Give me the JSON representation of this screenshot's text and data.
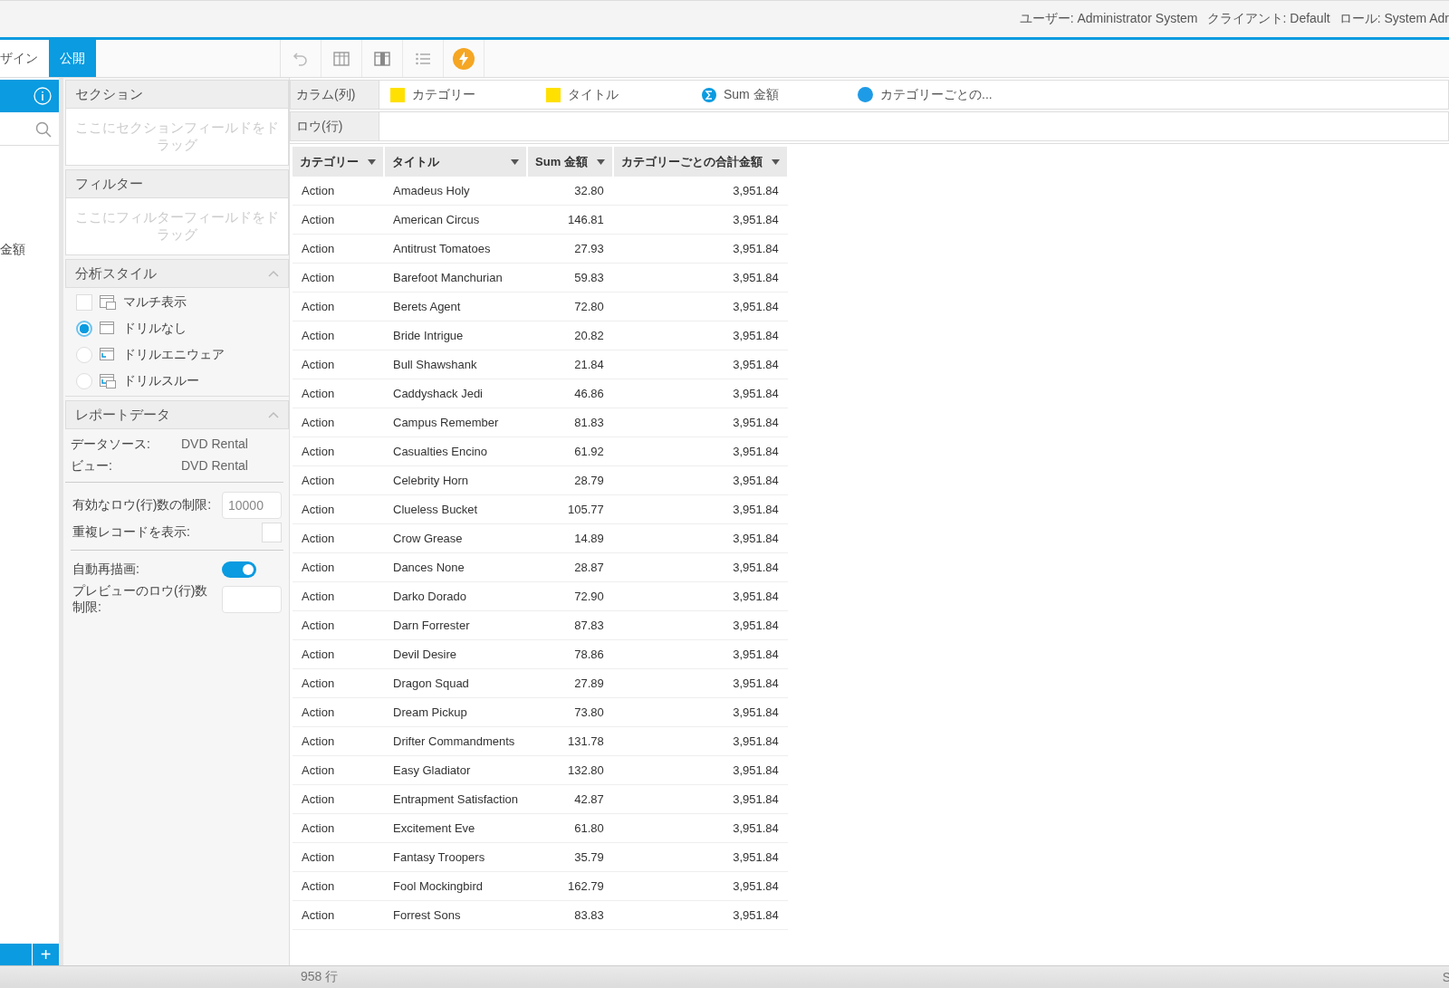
{
  "header": {
    "items": [
      "ユーザー: Administrator System",
      "クライアント: Default",
      "ロール: System Adr"
    ]
  },
  "tabs": [
    {
      "label": "ザイン",
      "selected": false
    },
    {
      "label": "公開",
      "selected": true
    }
  ],
  "sidebar": {
    "partial_label": "金額",
    "add_button": "+"
  },
  "section_panel": {
    "title": "セクション",
    "placeholder": "ここにセクションフィールドをドラッグ"
  },
  "filter_panel": {
    "title": "フィルター",
    "placeholder": "ここにフィルターフィールドをドラッグ"
  },
  "analysis_style": {
    "title": "分析スタイル",
    "expanded": true,
    "options": [
      {
        "label": "マルチ表示",
        "kind": "checkbox",
        "checked": false
      },
      {
        "label": "ドリルなし",
        "kind": "radio",
        "selected": true
      },
      {
        "label": "ドリルエニウェア",
        "kind": "radio",
        "selected": false
      },
      {
        "label": "ドリルスルー",
        "kind": "radio",
        "selected": false
      }
    ]
  },
  "report_data": {
    "title": "レポートデータ",
    "expanded": true,
    "info": [
      {
        "label": "データソース:",
        "value": "DVD Rental"
      },
      {
        "label": "ビュー:",
        "value": "DVD Rental"
      }
    ],
    "row_limit": {
      "label": "有効なロウ(行)数の制限:",
      "value": "10000"
    },
    "duplicates": {
      "label": "重複レコードを表示:",
      "checked": false
    },
    "auto_refresh": {
      "label": "自動再描画:",
      "on": true
    },
    "preview_limit": {
      "label": "プレビューのロウ(行)数制限:"
    }
  },
  "columns_shelf": {
    "label": "カラム(列)",
    "items": [
      {
        "label": "カテゴリー",
        "kind": "dimension"
      },
      {
        "label": "タイトル",
        "kind": "dimension"
      },
      {
        "label": "Sum 金額",
        "kind": "measure"
      },
      {
        "label": "カテゴリーごとの...",
        "kind": "calculated"
      }
    ]
  },
  "rows_shelf": {
    "label": "ロウ(行)"
  },
  "table": {
    "columns": [
      "カテゴリー",
      "タイトル",
      "Sum 金額",
      "カテゴリーごとの合計金額"
    ],
    "rows": [
      [
        "Action",
        "Amadeus Holy",
        "32.80",
        "3,951.84"
      ],
      [
        "Action",
        "American Circus",
        "146.81",
        "3,951.84"
      ],
      [
        "Action",
        "Antitrust Tomatoes",
        "27.93",
        "3,951.84"
      ],
      [
        "Action",
        "Barefoot Manchurian",
        "59.83",
        "3,951.84"
      ],
      [
        "Action",
        "Berets Agent",
        "72.80",
        "3,951.84"
      ],
      [
        "Action",
        "Bride Intrigue",
        "20.82",
        "3,951.84"
      ],
      [
        "Action",
        "Bull Shawshank",
        "21.84",
        "3,951.84"
      ],
      [
        "Action",
        "Caddyshack Jedi",
        "46.86",
        "3,951.84"
      ],
      [
        "Action",
        "Campus Remember",
        "81.83",
        "3,951.84"
      ],
      [
        "Action",
        "Casualties Encino",
        "61.92",
        "3,951.84"
      ],
      [
        "Action",
        "Celebrity Horn",
        "28.79",
        "3,951.84"
      ],
      [
        "Action",
        "Clueless Bucket",
        "105.77",
        "3,951.84"
      ],
      [
        "Action",
        "Crow Grease",
        "14.89",
        "3,951.84"
      ],
      [
        "Action",
        "Dances None",
        "28.87",
        "3,951.84"
      ],
      [
        "Action",
        "Darko Dorado",
        "72.90",
        "3,951.84"
      ],
      [
        "Action",
        "Darn Forrester",
        "87.83",
        "3,951.84"
      ],
      [
        "Action",
        "Devil Desire",
        "78.86",
        "3,951.84"
      ],
      [
        "Action",
        "Dragon Squad",
        "27.89",
        "3,951.84"
      ],
      [
        "Action",
        "Dream Pickup",
        "73.80",
        "3,951.84"
      ],
      [
        "Action",
        "Drifter Commandments",
        "131.78",
        "3,951.84"
      ],
      [
        "Action",
        "Easy Gladiator",
        "132.80",
        "3,951.84"
      ],
      [
        "Action",
        "Entrapment Satisfaction",
        "42.87",
        "3,951.84"
      ],
      [
        "Action",
        "Excitement Eve",
        "61.80",
        "3,951.84"
      ],
      [
        "Action",
        "Fantasy Troopers",
        "35.79",
        "3,951.84"
      ],
      [
        "Action",
        "Fool Mockingbird",
        "162.79",
        "3,951.84"
      ],
      [
        "Action",
        "Forrest Sons",
        "83.83",
        "3,951.84"
      ]
    ]
  },
  "status_bar": {
    "row_count": "958 行",
    "right_text": "S"
  }
}
